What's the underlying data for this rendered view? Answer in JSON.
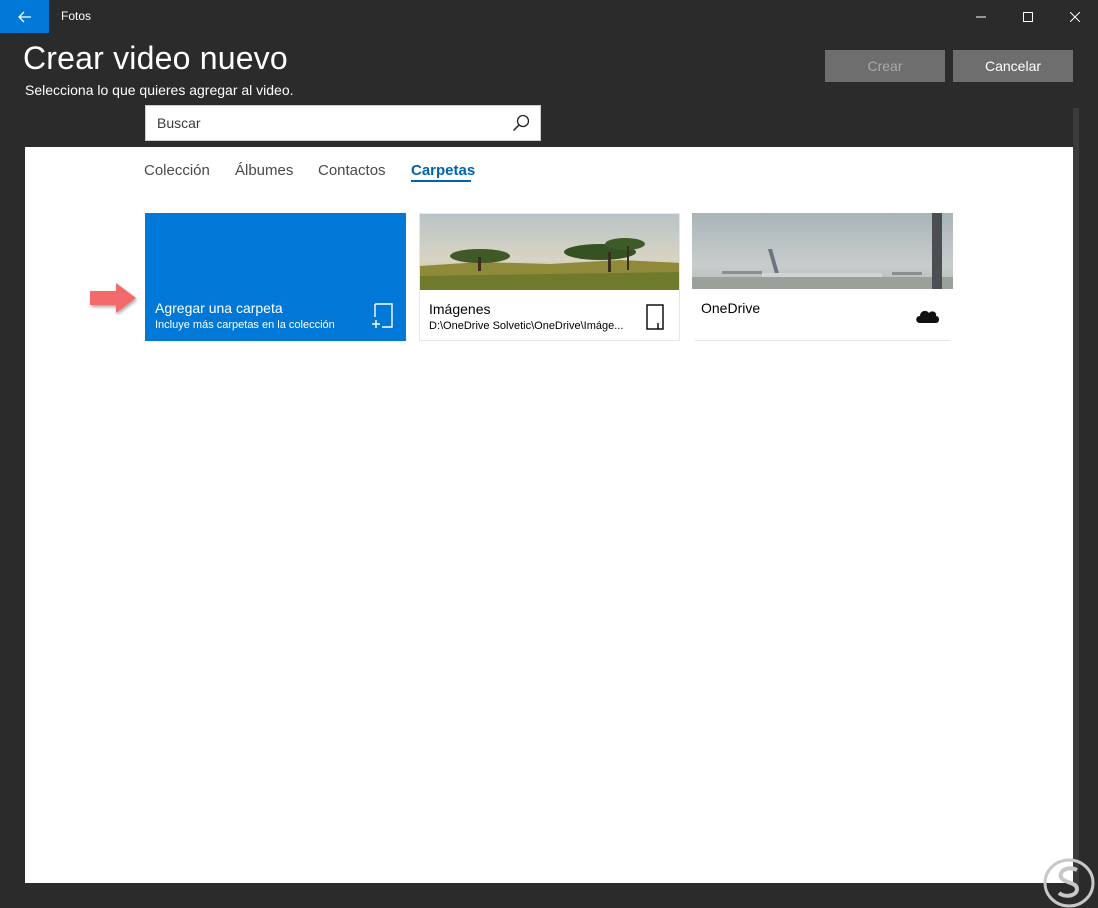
{
  "window": {
    "app_title": "Fotos"
  },
  "header": {
    "title": "Crear video nuevo",
    "subtitle": "Selecciona lo que quieres agregar al video."
  },
  "buttons": {
    "create_label": "Crear",
    "cancel_label": "Cancelar"
  },
  "search": {
    "placeholder": "Buscar",
    "value": ""
  },
  "tabs": [
    {
      "label": "Colección",
      "active": false
    },
    {
      "label": "Álbumes",
      "active": false
    },
    {
      "label": "Contactos",
      "active": false
    },
    {
      "label": "Carpetas",
      "active": true
    }
  ],
  "tiles": {
    "add": {
      "title": "Agregar una carpeta",
      "subtitle": "Incluye más carpetas en la colección",
      "icon": "add-folder-icon"
    },
    "images": {
      "title": "Imágenes",
      "path": "D:\\OneDrive Solvetic\\OneDrive\\Imáge...",
      "icon": "device-folder-icon"
    },
    "onedrive": {
      "title": "OneDrive",
      "icon": "cloud-icon"
    }
  },
  "colors": {
    "accent": "#0078d7",
    "tab_active": "#0063b1",
    "chrome": "#2b2b2b",
    "arrow": "#f26b6b"
  }
}
